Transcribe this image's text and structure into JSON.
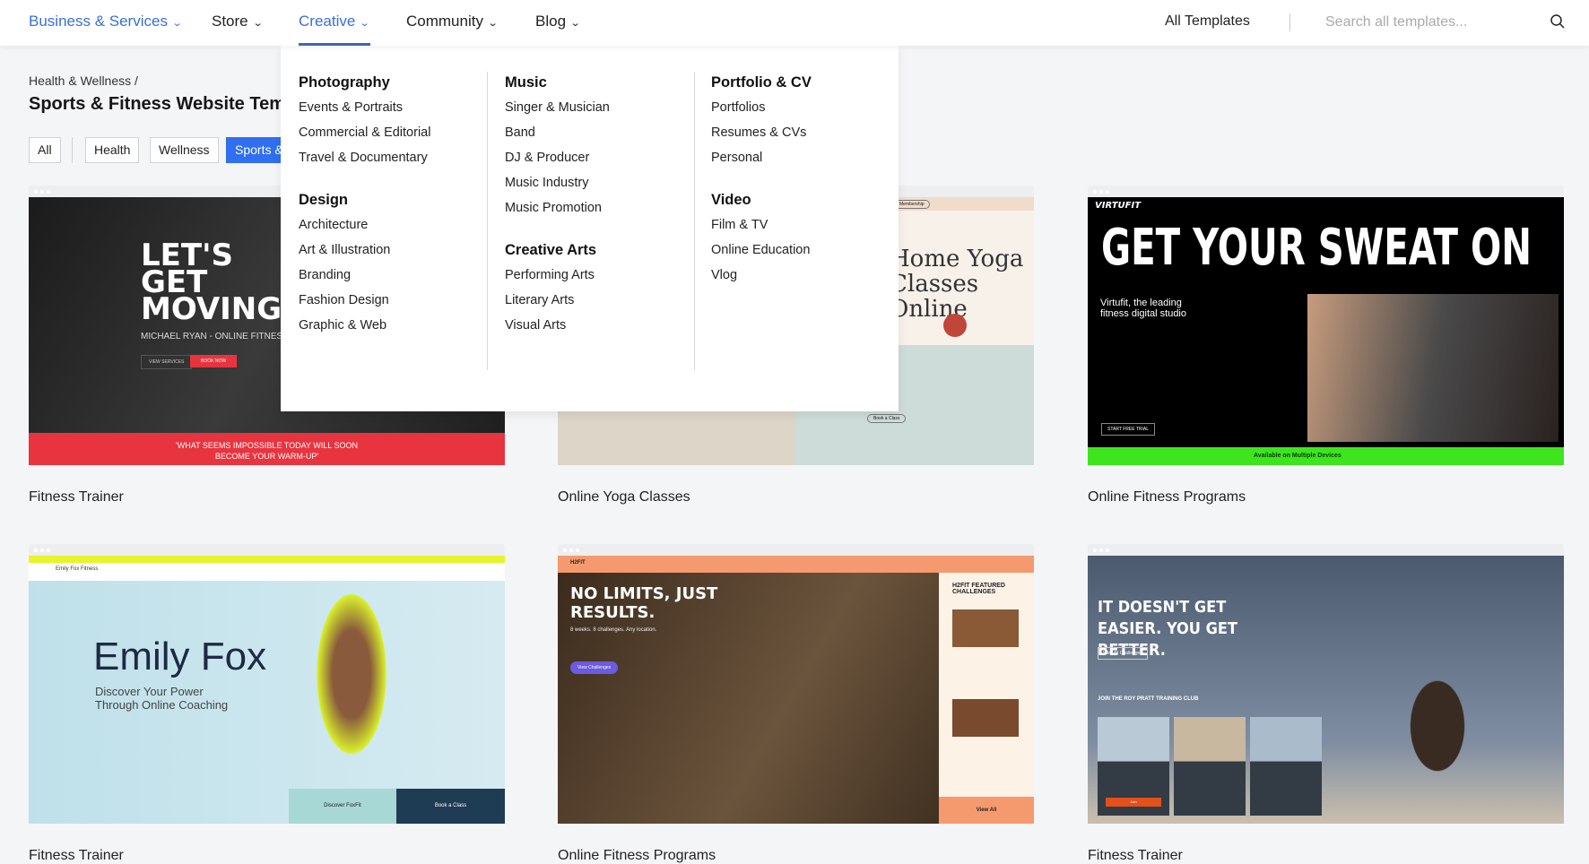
{
  "header": {
    "nav": [
      {
        "label": "Business & Services",
        "active": false
      },
      {
        "label": "Store",
        "active": false
      },
      {
        "label": "Creative",
        "active": true
      },
      {
        "label": "Community",
        "active": false
      },
      {
        "label": "Blog",
        "active": false
      }
    ],
    "all_templates": "All Templates",
    "search_placeholder": "Search all templates...",
    "search_icon": "search-icon",
    "accent": "#3a6fd8"
  },
  "dropdown": {
    "columns": [
      {
        "groups": [
          {
            "heading": "Photography",
            "items": [
              "Events & Portraits",
              "Commercial & Editorial",
              "Travel & Documentary"
            ]
          },
          {
            "heading": "Design",
            "items": [
              "Architecture",
              "Art & Illustration",
              "Branding",
              "Fashion Design",
              "Graphic & Web"
            ]
          }
        ]
      },
      {
        "groups": [
          {
            "heading": "Music",
            "items": [
              "Singer & Musician",
              "Band",
              "DJ & Producer",
              "Music Industry",
              "Music Promotion"
            ]
          },
          {
            "heading": "Creative Arts",
            "items": [
              "Performing Arts",
              "Literary Arts",
              "Visual Arts"
            ]
          }
        ]
      },
      {
        "groups": [
          {
            "heading": "Portfolio & CV",
            "items": [
              "Portfolios",
              "Resumes & CVs",
              "Personal"
            ]
          },
          {
            "heading": "Video",
            "items": [
              "Film & TV",
              "Online Education",
              "Vlog"
            ]
          }
        ]
      }
    ]
  },
  "page": {
    "breadcrumb": "Health & Wellness /",
    "title": "Sports & Fitness Website Templates",
    "filters": [
      "All",
      "Health",
      "Wellness",
      "Sports & Fitness"
    ],
    "active_filter": "Sports & Fitness"
  },
  "cards": [
    {
      "label": "Fitness Trainer",
      "headline": "LET'S GET MOVING",
      "sub": "MICHAEL RYAN - ONLINE FITNESS COACH",
      "banner": "'WHAT SEEMS IMPOSSIBLE TODAY WILL SOON BECOME YOUR WARM-UP'",
      "btn1": "VIEW SERVICES",
      "btn2": "BOOK NOW"
    },
    {
      "label": "Online Yoga Classes",
      "headline": "Home Yoga Classes Online",
      "btn1": "Membership",
      "btn2": "Book a Class"
    },
    {
      "label": "Online Fitness Programs",
      "headline": "GET YOUR SWEAT ON",
      "logo": "VIRTUFIT",
      "sub": "Virtufit, the leading fitness digital studio",
      "btn1": "START FREE TRIAL",
      "banner": "Available on Multiple Devices"
    },
    {
      "label": "Fitness Trainer",
      "headline": "Emily Fox",
      "sub": "Discover Your Power Through Online Coaching",
      "logo": "Emily Fox Fitness",
      "btn1": "Discover FoxFit",
      "btn2": "Book a Class"
    },
    {
      "label": "Online Fitness Programs",
      "headline": "NO LIMITS, JUST RESULTS.",
      "logo": "H2FIT",
      "sub": "8 weeks. 8 challenges. Any location.",
      "btn1": "View Challenges",
      "side": "H2FIT FEATURED CHALLENGES",
      "btn2": "View All"
    },
    {
      "label": "Fitness Trainer",
      "headline": "IT DOESN'T GET EASIER. YOU GET BETTER.",
      "sub": "JOIN THE ROY PRATT TRAINING CLUB",
      "btn1": "View All Challenges",
      "btn2": "Join"
    }
  ]
}
